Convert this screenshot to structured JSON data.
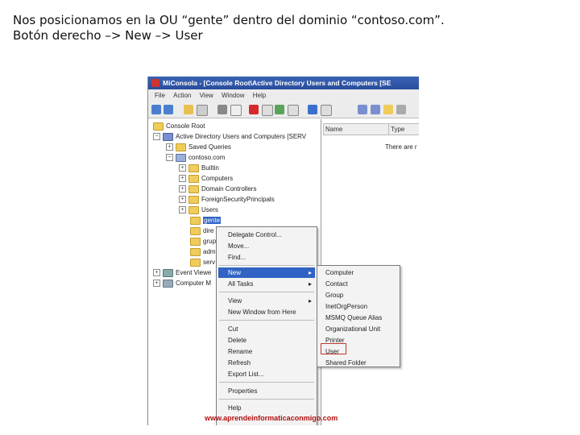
{
  "caption": {
    "line1": "Nos posicionamos en la OU “gente” dentro del dominio “contoso.com”.",
    "line2": "Botón derecho –> New –> User"
  },
  "window": {
    "title": "MiConsola - [Console Root\\Active Directory Users and Computers [SE",
    "menus": [
      "File",
      "Action",
      "View",
      "Window",
      "Help"
    ]
  },
  "tree": {
    "console_root": "Console Root",
    "aduc": "Active Directory Users and Computers [SERV",
    "saved_queries": "Saved Queries",
    "domain": "contoso.com",
    "builtin": "Builtin",
    "computers": "Computers",
    "domain_controllers": "Domain Controllers",
    "fsp": "ForeignSecurityPrincipals",
    "users": "Users",
    "gente": "gente",
    "ou2": "dire",
    "ou3": "grup",
    "ou4": "adm",
    "ou5": "serv",
    "event_viewer": "Event Viewe",
    "computer_mgmt": "Computer M"
  },
  "right_pane": {
    "col_name": "Name",
    "col_type": "Type",
    "empty_text": "There are r"
  },
  "context_menu": {
    "delegate": "Delegate Control...",
    "move": "Move...",
    "find": "Find...",
    "new": "New",
    "all_tasks": "All Tasks",
    "view": "View",
    "new_window": "New Window from Here",
    "cut": "Cut",
    "delete": "Delete",
    "rename": "Rename",
    "refresh": "Refresh",
    "export": "Export List...",
    "properties": "Properties",
    "help": "Help"
  },
  "submenu": {
    "computer": "Computer",
    "contact": "Contact",
    "group": "Group",
    "inetorgperson": "InetOrgPerson",
    "msmq": "MSMQ Queue Alias",
    "ou": "Organizational Unit",
    "printer": "Printer",
    "user": "User",
    "shared_folder": "Shared Folder"
  },
  "footer_url": "www.aprendeinformaticaconmigo.com",
  "colors": {
    "title_bar": "#2a4d9c",
    "highlight": "#c0392b",
    "url": "#b01010"
  }
}
